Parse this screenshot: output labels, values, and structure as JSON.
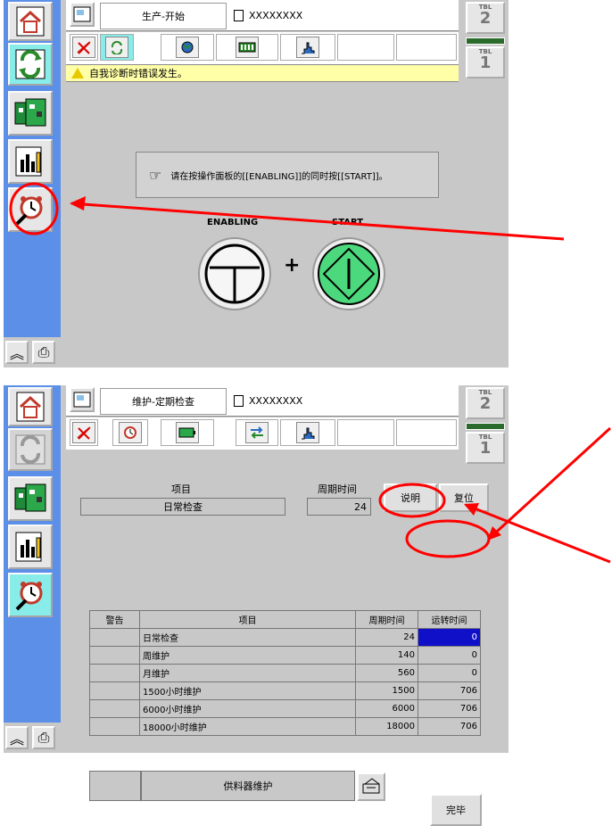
{
  "screen1": {
    "title": "生产-开始",
    "program": "XXXXXXXX",
    "status_message": "自我诊断时错误发生。",
    "instruction": "请在按操作面板的[[ENABLING]]的同时按[[START]]。",
    "enabling_label": "ENABLING",
    "start_label": "START",
    "plus": "+",
    "tbl_top": {
      "label": "TBL",
      "number": "2"
    },
    "tbl_bottom": {
      "label": "TBL",
      "number": "1"
    }
  },
  "screen2": {
    "title": "维护-定期检查",
    "program": "XXXXXXXX",
    "tbl_top": {
      "label": "TBL",
      "number": "2"
    },
    "tbl_bottom": {
      "label": "TBL",
      "number": "1"
    },
    "item_header": "项目",
    "cycle_header": "周期时间",
    "item_value": "日常检查",
    "cycle_value": "24",
    "explain_button": "说明",
    "reset_button": "复位",
    "table_headers": [
      "警告",
      "项目",
      "周期时间",
      "运转时间"
    ],
    "rows": [
      {
        "warn": "",
        "item": "日常检查",
        "cycle": "24",
        "run": "0"
      },
      {
        "warn": "",
        "item": "周维护",
        "cycle": "140",
        "run": "0"
      },
      {
        "warn": "",
        "item": "月维护",
        "cycle": "560",
        "run": "0"
      },
      {
        "warn": "",
        "item": "1500小时维护",
        "cycle": "1500",
        "run": "706"
      },
      {
        "warn": "",
        "item": "6000小时维护",
        "cycle": "6000",
        "run": "706"
      },
      {
        "warn": "",
        "item": "18000小时维护",
        "cycle": "18000",
        "run": "706"
      }
    ],
    "feeder_label": "供料器维护",
    "finish_button": "完毕"
  },
  "icons": {
    "home": "home-icon",
    "production": "production-icon",
    "board": "board-icon",
    "chart": "chart-icon",
    "maintenance": "alarm-clock-wrench-icon",
    "print": "printer-icon",
    "collapse": "double-chevron-up-icon"
  },
  "colors": {
    "sidebar": "#5b8fe8",
    "active": "#88ece8",
    "status_bg": "#ffffa8",
    "start_green": "#4cd87c",
    "selection": "#1010c8",
    "annotation": "#ff0000"
  }
}
